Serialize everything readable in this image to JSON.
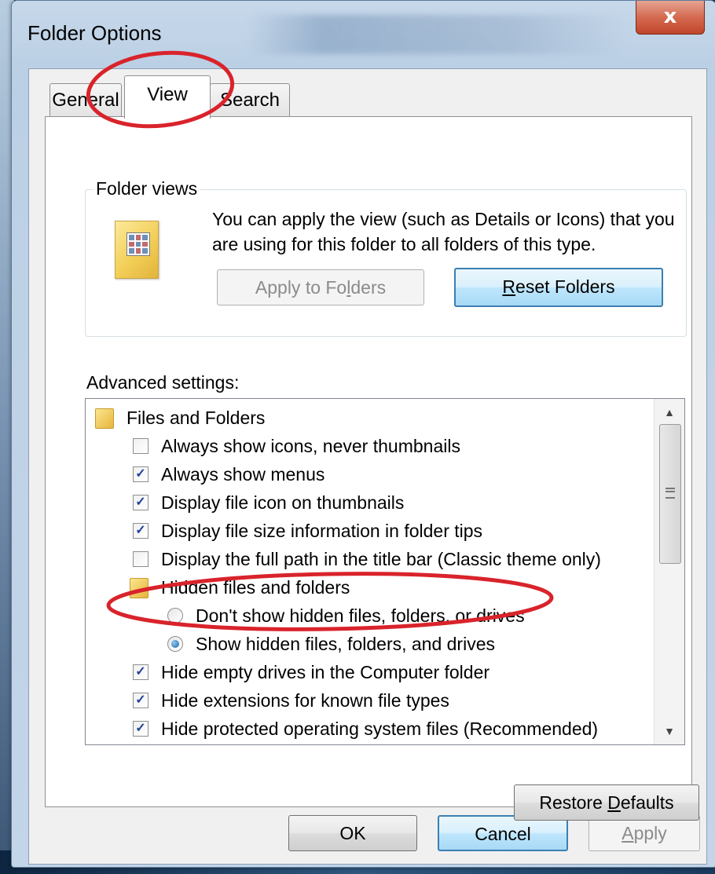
{
  "window": {
    "title": "Folder Options",
    "close_glyph": "x"
  },
  "tabs": [
    {
      "label": "General",
      "selected": false
    },
    {
      "label": "View",
      "selected": true
    },
    {
      "label": "Search",
      "selected": false
    }
  ],
  "folder_views": {
    "label": "Folder views",
    "description": "You can apply the view (such as Details or Icons) that you are using for this folder to all folders of this type.",
    "icon": "folder-view-icon",
    "apply_button": {
      "pre": "Apply to Fo",
      "mnemonic": "l",
      "post": "ders",
      "enabled": false
    },
    "reset_button": {
      "pre": "",
      "mnemonic": "R",
      "post": "eset Folders",
      "enabled": true
    }
  },
  "advanced": {
    "label": "Advanced settings:",
    "items": [
      {
        "type": "folder",
        "label": "Files and Folders",
        "level": 0
      },
      {
        "type": "checkbox",
        "label": "Always show icons, never thumbnails",
        "checked": false,
        "level": 1
      },
      {
        "type": "checkbox",
        "label": "Always show menus",
        "checked": true,
        "level": 1
      },
      {
        "type": "checkbox",
        "label": "Display file icon on thumbnails",
        "checked": true,
        "level": 1
      },
      {
        "type": "checkbox",
        "label": "Display file size information in folder tips",
        "checked": true,
        "level": 1
      },
      {
        "type": "checkbox",
        "label": "Display the full path in the title bar (Classic theme only)",
        "checked": false,
        "level": 1
      },
      {
        "type": "folder",
        "label": "Hidden files and folders",
        "level": 1
      },
      {
        "type": "radio",
        "label": "Don't show hidden files, folders, or drives",
        "checked": false,
        "level": 2
      },
      {
        "type": "radio",
        "label": "Show hidden files, folders, and drives",
        "checked": true,
        "level": 2
      },
      {
        "type": "checkbox",
        "label": "Hide empty drives in the Computer folder",
        "checked": true,
        "level": 1
      },
      {
        "type": "checkbox",
        "label": "Hide extensions for known file types",
        "checked": true,
        "level": 1
      },
      {
        "type": "checkbox",
        "label": "Hide protected operating system files (Recommended)",
        "checked": true,
        "level": 1
      }
    ]
  },
  "buttons": {
    "restore": {
      "pre": "Restore ",
      "mnemonic": "D",
      "post": "efaults"
    },
    "ok": "OK",
    "cancel": "Cancel",
    "apply": {
      "pre": "",
      "mnemonic": "A",
      "post": "pply",
      "enabled": false
    }
  },
  "check_glyph": "✓",
  "annotation_color": "#d9232b"
}
